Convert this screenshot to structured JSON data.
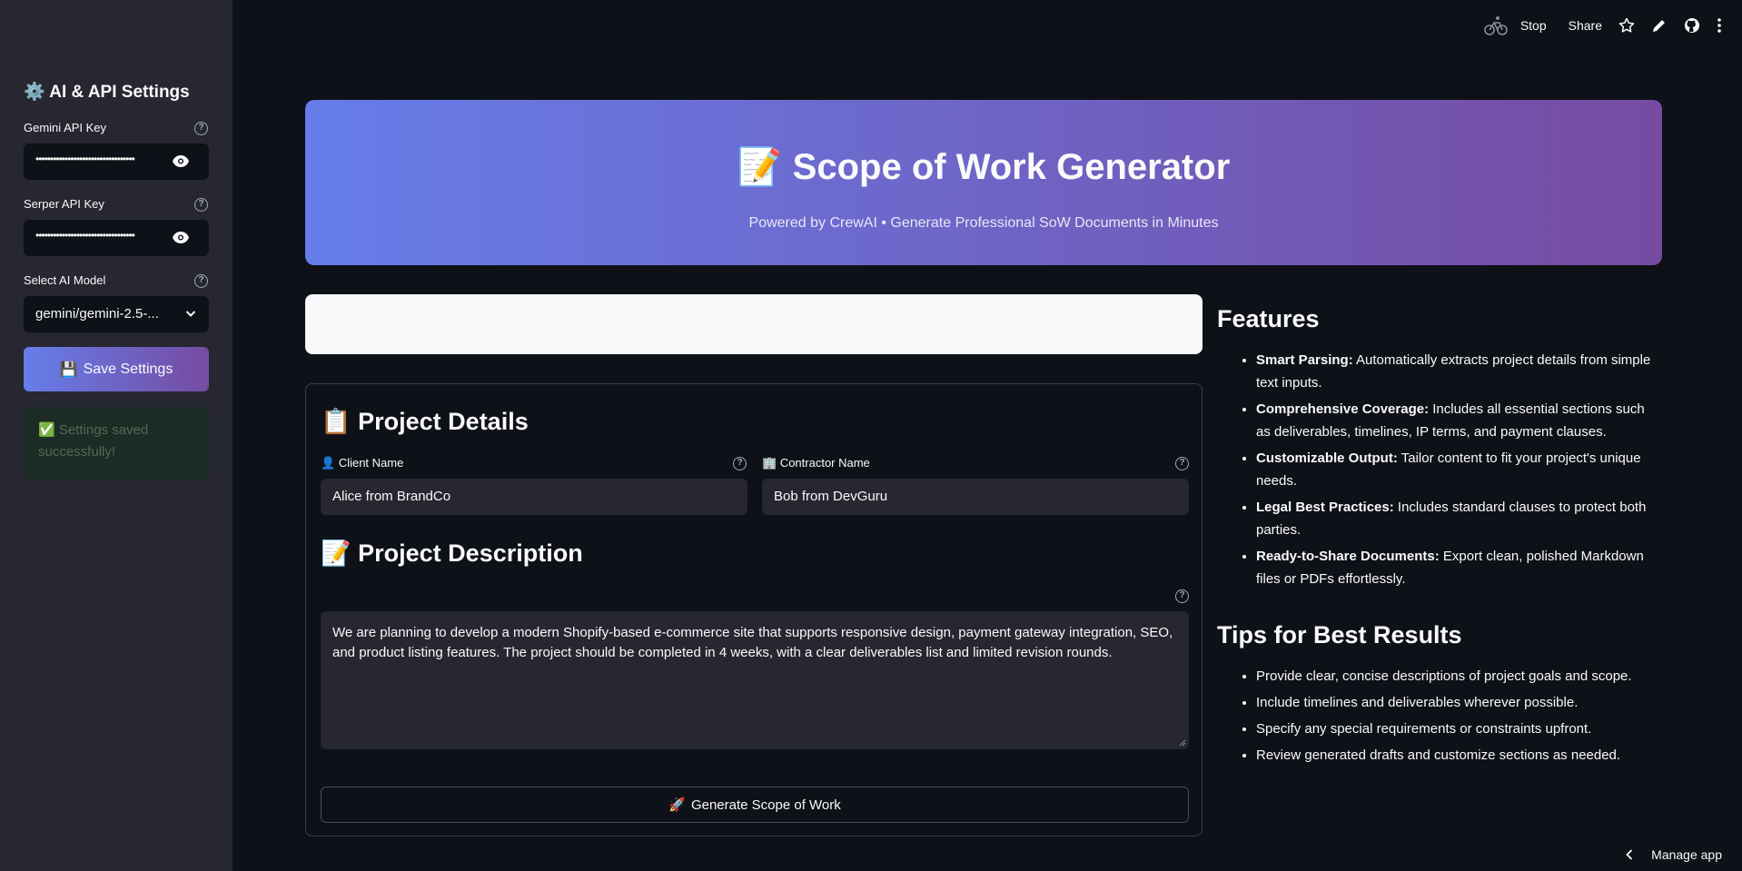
{
  "toolbar": {
    "stop_label": "Stop",
    "share_label": "Share",
    "icons": [
      "running-bike-icon",
      "star-icon",
      "pencil-icon",
      "github-icon",
      "more-vertical-icon"
    ]
  },
  "sidebar": {
    "title_emoji": "⚙️",
    "title": "AI & API Settings",
    "gemini_label": "Gemini API Key",
    "gemini_value": "••••••••••••••••••••••••••••••••••",
    "serper_label": "Serper API Key",
    "serper_value": "••••••••••••••••••••••••••••••••••",
    "model_label": "Select AI Model",
    "model_value": "gemini/gemini-2.5-...",
    "save_emoji": "💾",
    "save_label": "Save Settings",
    "success_text": "✅ Settings saved successfully!"
  },
  "hero": {
    "emoji": "📝",
    "title": "Scope of Work Generator",
    "subtitle": "Powered by CrewAI • Generate Professional SoW Documents in Minutes"
  },
  "form": {
    "details_emoji": "📋",
    "details_title": "Project Details",
    "client_emoji": "👤",
    "client_label": "Client Name",
    "client_value": "Alice from BrandCo",
    "contractor_emoji": "🏢",
    "contractor_label": "Contractor Name",
    "contractor_value": "Bob from DevGuru",
    "description_emoji": "📝",
    "description_title": "Project Description",
    "description_value": "We are planning to develop a modern Shopify-based e-commerce site that supports responsive design, payment gateway integration, SEO, and product listing features. The project should be completed in 4 weeks, with a clear deliverables list and limited revision rounds.",
    "generate_emoji": "🚀",
    "generate_label": "Generate Scope of Work"
  },
  "features": {
    "title": "Features",
    "items": [
      {
        "bold": "Smart Parsing:",
        "text": " Automatically extracts project details from simple text inputs."
      },
      {
        "bold": "Comprehensive Coverage:",
        "text": " Includes all essential sections such as deliverables, timelines, IP terms, and payment clauses."
      },
      {
        "bold": "Customizable Output:",
        "text": " Tailor content to fit your project's unique needs."
      },
      {
        "bold": "Legal Best Practices:",
        "text": " Includes standard clauses to protect both parties."
      },
      {
        "bold": "Ready-to-Share Documents:",
        "text": " Export clean, polished Markdown files or PDFs effortlessly."
      }
    ]
  },
  "tips": {
    "title": "Tips for Best Results",
    "items": [
      "Provide clear, concise descriptions of project goals and scope.",
      "Include timelines and deliverables wherever possible.",
      "Specify any special requirements or constraints upfront.",
      "Review generated drafts and customize sections as needed."
    ]
  },
  "footer": {
    "manage_label": "Manage app"
  }
}
